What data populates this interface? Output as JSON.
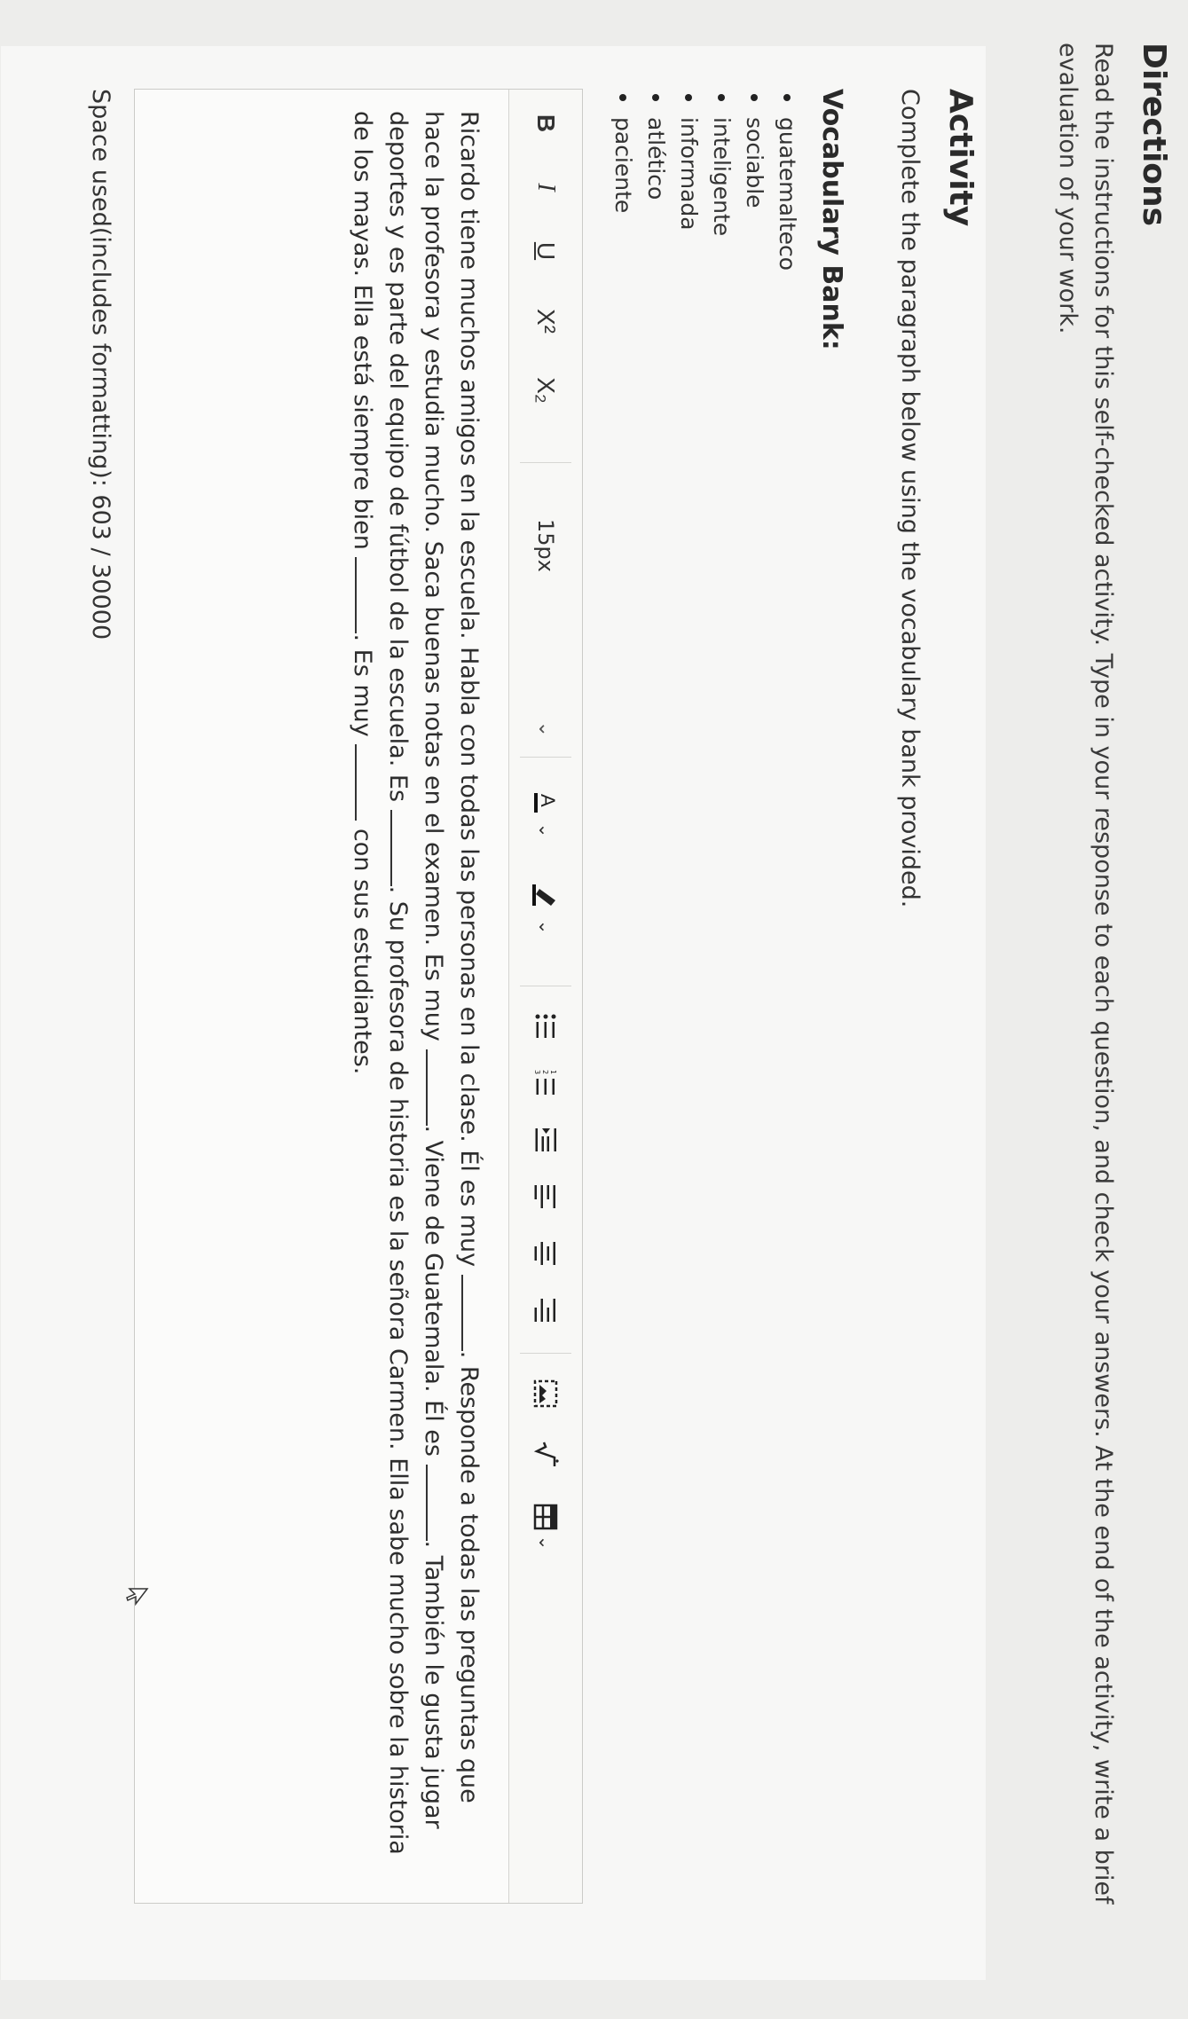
{
  "directions": {
    "title": "Directions",
    "text": "Read the instructions for this self-checked activity. Type in your response to each question, and check your answers. At the end of the activity, write a brief evaluation of your work."
  },
  "activity": {
    "title": "Activity",
    "instructions": "Complete the paragraph below using the vocabulary bank provided.",
    "vocab_title": "Vocabulary Bank:",
    "vocab": [
      "guatemalteco",
      "sociable",
      "inteligente",
      "informada",
      "atlético",
      "paciente"
    ]
  },
  "toolbar": {
    "bold": "B",
    "italic": "I",
    "underline": "U",
    "superscript": "X²",
    "subscript": "X₂",
    "font_size": "15px"
  },
  "paragraph": {
    "s1": "Ricardo tiene muchos amigos en la escuela. Habla con todas las personas en la clase. Él es muy",
    "s2": ". Responde a todas las preguntas que hace la profesora y estudia mucho. Saca buenas notas en el examen. Es muy",
    "s3": ". Viene de Guatemala. Él es",
    "s4": ". También le gusta jugar deportes y es parte del equipo de fútbol de la escuela. Es",
    "s5": ". Su profesora de historia es la señora Carmen. Ella sabe mucho sobre la historia de los mayas. Ella está siempre bien",
    "s6": ". Es muy",
    "s7": "con sus estudiantes."
  },
  "counter": "Space used(includes formatting): 603 / 30000"
}
